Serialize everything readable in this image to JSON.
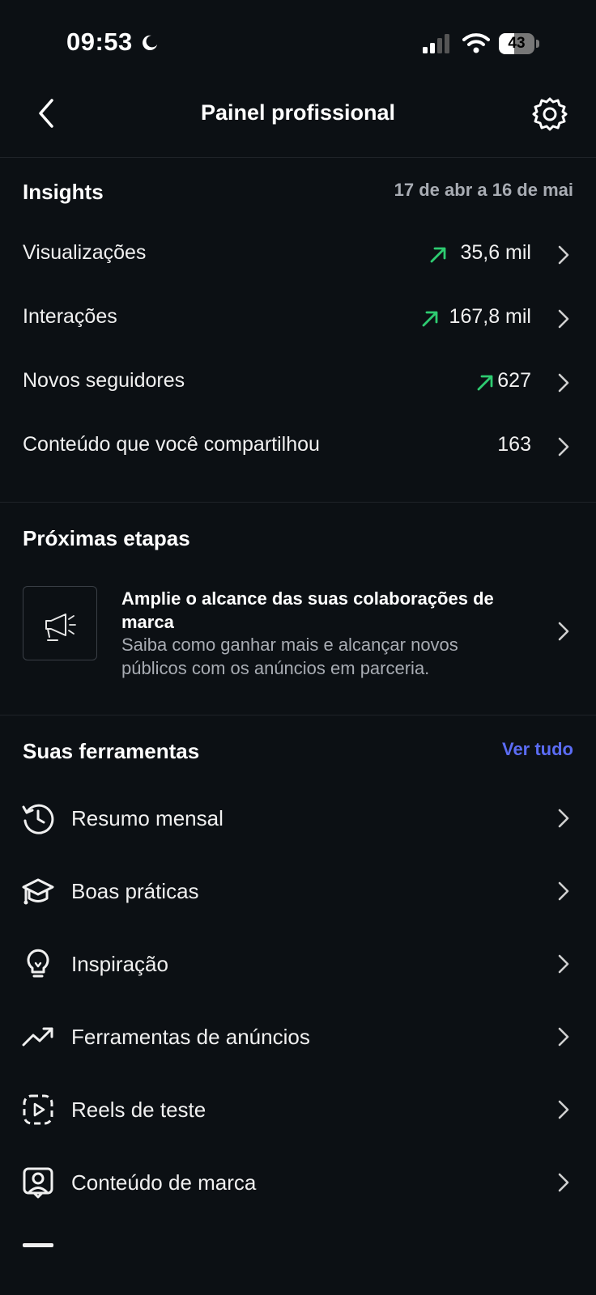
{
  "status_bar": {
    "time": "09:53",
    "battery_percent": "43",
    "battery_level": 0.43,
    "icons": [
      "moon-icon",
      "signal-icon",
      "wifi-icon",
      "battery-icon"
    ]
  },
  "header": {
    "title": "Painel profissional",
    "back_icon": "chevron-left-icon",
    "settings_icon": "gear-icon"
  },
  "insights": {
    "title": "Insights",
    "date_range": "17 de abr a 16 de mai",
    "rows": [
      {
        "label": "Visualizações",
        "value": "35,6 mil",
        "trend": "up"
      },
      {
        "label": "Interações",
        "value": "167,8 mil",
        "trend": "up"
      },
      {
        "label": "Novos seguidores",
        "value": "627",
        "trend": "up"
      },
      {
        "label": "Conteúdo que você compartilhou",
        "value": "163",
        "trend": "none"
      }
    ]
  },
  "next_steps": {
    "title": "Próximas etapas",
    "card": {
      "icon": "megaphone-icon",
      "title": "Amplie o alcance das suas colaborações de marca",
      "subtitle": "Saiba como ganhar mais e alcançar novos públicos com os anúncios em parceria."
    }
  },
  "tools": {
    "title": "Suas ferramentas",
    "see_all": "Ver tudo",
    "items": [
      {
        "label": "Resumo mensal",
        "icon": "history-clock-icon"
      },
      {
        "label": "Boas práticas",
        "icon": "graduation-cap-icon"
      },
      {
        "label": "Inspiração",
        "icon": "lightbulb-icon"
      },
      {
        "label": "Ferramentas de anúncios",
        "icon": "trend-up-icon"
      },
      {
        "label": "Reels de teste",
        "icon": "reels-test-icon"
      },
      {
        "label": "Conteúdo de marca",
        "icon": "branded-content-icon"
      }
    ]
  },
  "colors": {
    "background": "#0c1014",
    "trend_green": "#2ecc71",
    "link_blue": "#5b6cf4",
    "secondary_text": "#a8acb3"
  }
}
